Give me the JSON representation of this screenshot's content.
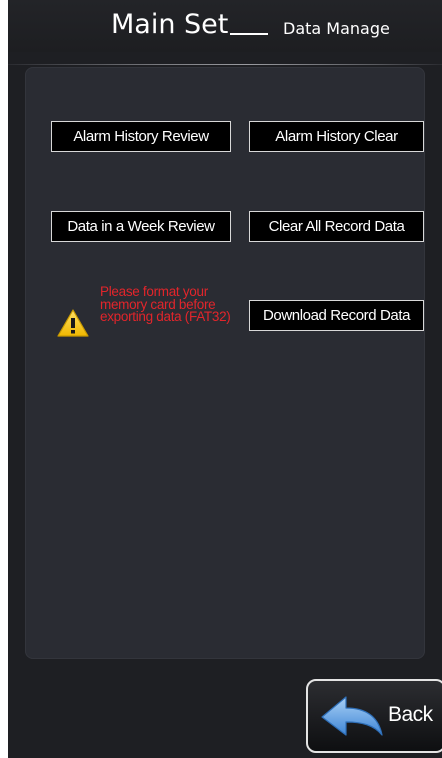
{
  "header": {
    "title": "Main Set",
    "subtitle": "Data Manage"
  },
  "buttons": {
    "alarm_history_review": "Alarm History Review",
    "alarm_history_clear": "Alarm History Clear",
    "data_week_review": "Data in a Week Review",
    "clear_all_record": "Clear All Record Data",
    "download_record": "Download Record Data"
  },
  "warning": {
    "icon": "warning-triangle-icon",
    "text": "Please format your memory card before exporting data (FAT32)",
    "color": "#e2252b"
  },
  "footer": {
    "back_label": "Back",
    "back_icon": "back-arrow-icon"
  },
  "colors": {
    "background": "#1e1f23",
    "panel": "#2a2c33",
    "button_bg": "#000000",
    "button_border": "#d8d8d8",
    "warning_yellow": "#f3c21b",
    "arrow_blue": "#6aa6e6"
  }
}
